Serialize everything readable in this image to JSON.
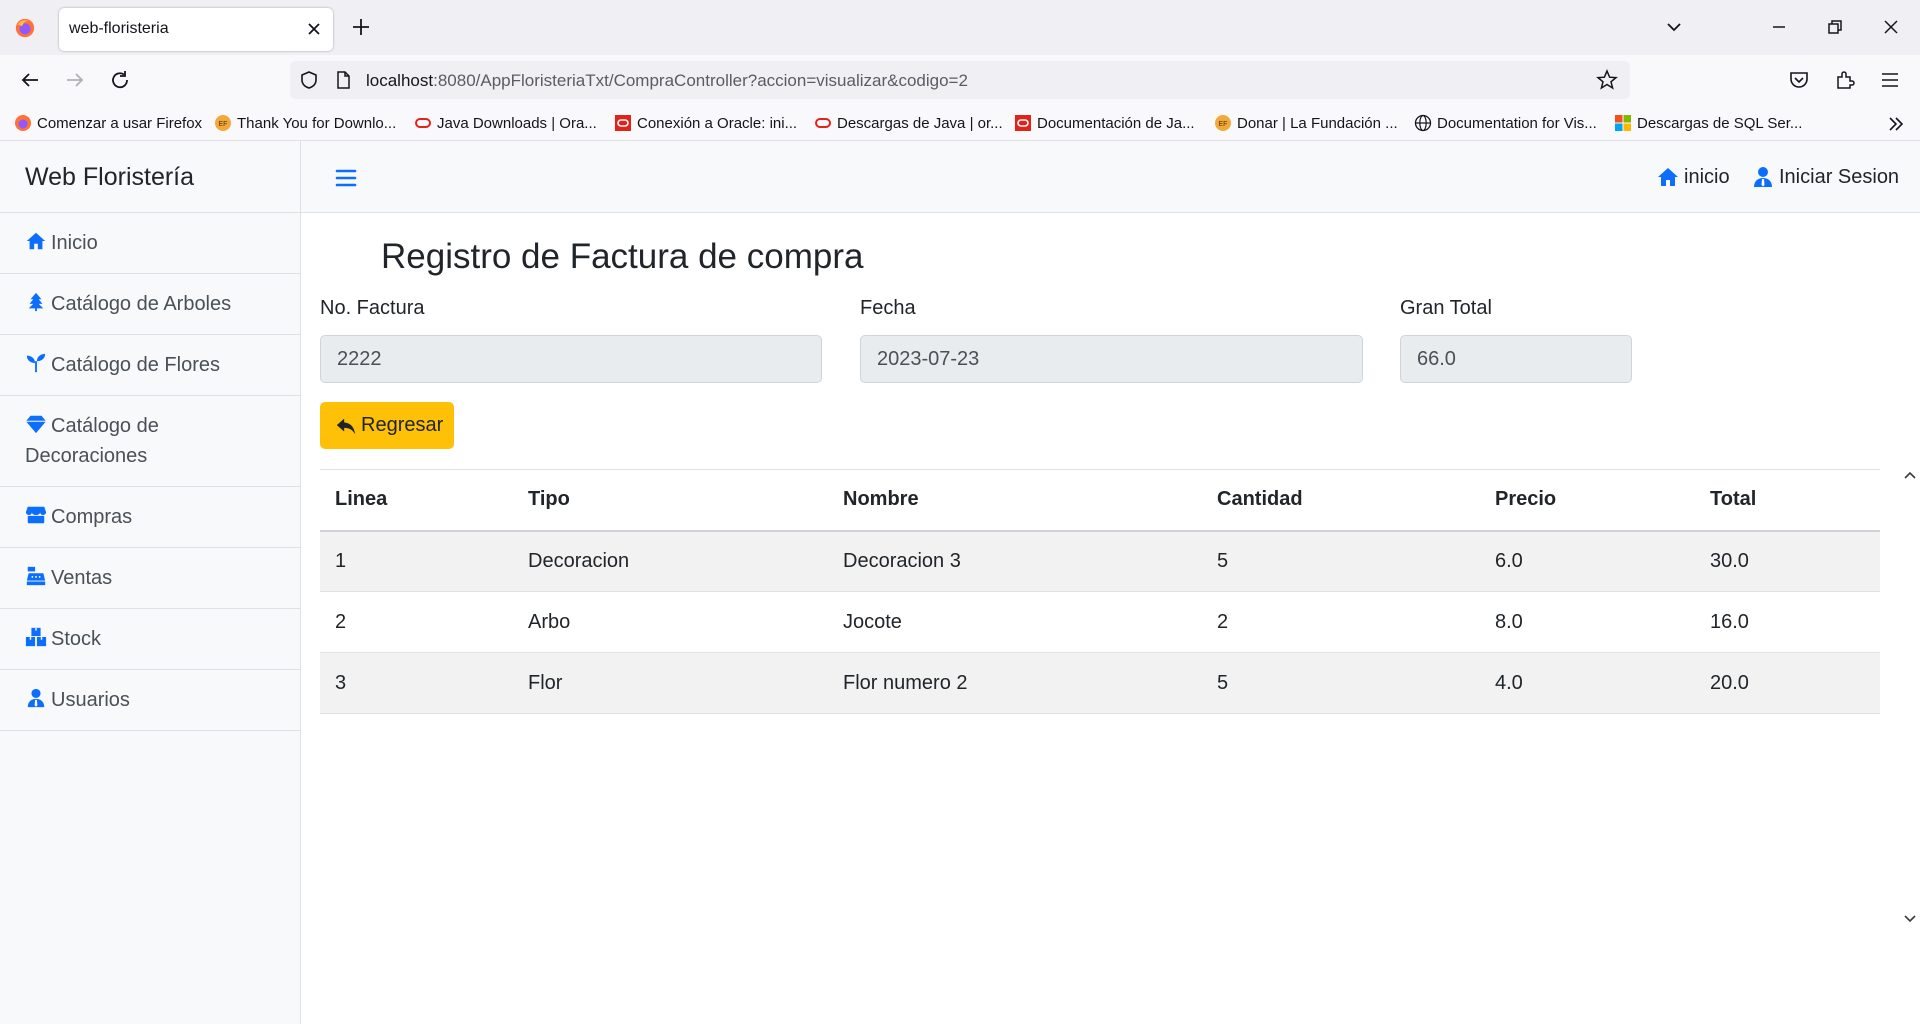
{
  "browser": {
    "tab_title": "web-floristeria",
    "url_host": "localhost",
    "url_rest": ":8080/AppFloristeriaTxt/CompraController?accion=visualizar&codigo=2",
    "bookmarks": [
      {
        "label": "Comenzar a usar Firefox",
        "icon": "firefox-icon"
      },
      {
        "label": "Thank You for Downlo...",
        "icon": "ef-icon"
      },
      {
        "label": "Java Downloads | Ora...",
        "icon": "oracle-ring-icon"
      },
      {
        "label": "Conexión a Oracle: ini...",
        "icon": "oracle-square-icon"
      },
      {
        "label": "Descargas de Java | or...",
        "icon": "oracle-ring-icon"
      },
      {
        "label": "Documentación de Ja...",
        "icon": "oracle-square-icon"
      },
      {
        "label": "Donar | La Fundación ...",
        "icon": "ef-icon"
      },
      {
        "label": "Documentation for Vis...",
        "icon": "globe-icon"
      },
      {
        "label": "Descargas de SQL Ser...",
        "icon": "microsoft-icon"
      }
    ]
  },
  "sidebar": {
    "brand": "Web Floristería",
    "items": [
      {
        "label": "Inicio",
        "icon": "home-icon"
      },
      {
        "label": "Catálogo de Arboles",
        "icon": "tree-icon"
      },
      {
        "label": "Catálogo de Flores",
        "icon": "seedling-icon"
      },
      {
        "label": "Catálogo de",
        "label2": "Decoraciones",
        "icon": "gem-icon"
      },
      {
        "label": "Compras",
        "icon": "store-icon"
      },
      {
        "label": "Ventas",
        "icon": "cash-register-icon"
      },
      {
        "label": "Stock",
        "icon": "boxes-icon"
      },
      {
        "label": "Usuarios",
        "icon": "user-tie-icon"
      }
    ]
  },
  "topbar": {
    "home_label": "inicio",
    "login_label": "Iniciar Sesion"
  },
  "main": {
    "title": "Registro de Factura de compra",
    "fields": {
      "invoice_label": "No. Factura",
      "invoice_value": "2222",
      "date_label": "Fecha",
      "date_value": "2023-07-23",
      "total_label": "Gran Total",
      "total_value": "66.0"
    },
    "back_button": "Regresar",
    "table": {
      "headers": [
        "Linea",
        "Tipo",
        "Nombre",
        "Cantidad",
        "Precio",
        "Total"
      ],
      "rows": [
        [
          "1",
          "Decoracion",
          "Decoracion 3",
          "5",
          "6.0",
          "30.0"
        ],
        [
          "2",
          "Arbo",
          "Jocote",
          "2",
          "8.0",
          "16.0"
        ],
        [
          "3",
          "Flor",
          "Flor numero 2",
          "5",
          "4.0",
          "20.0"
        ]
      ]
    }
  },
  "colors": {
    "accent_blue": "#0d6efd",
    "button_warning": "#ffc107",
    "sidebar_bg": "#f8f9fa"
  }
}
